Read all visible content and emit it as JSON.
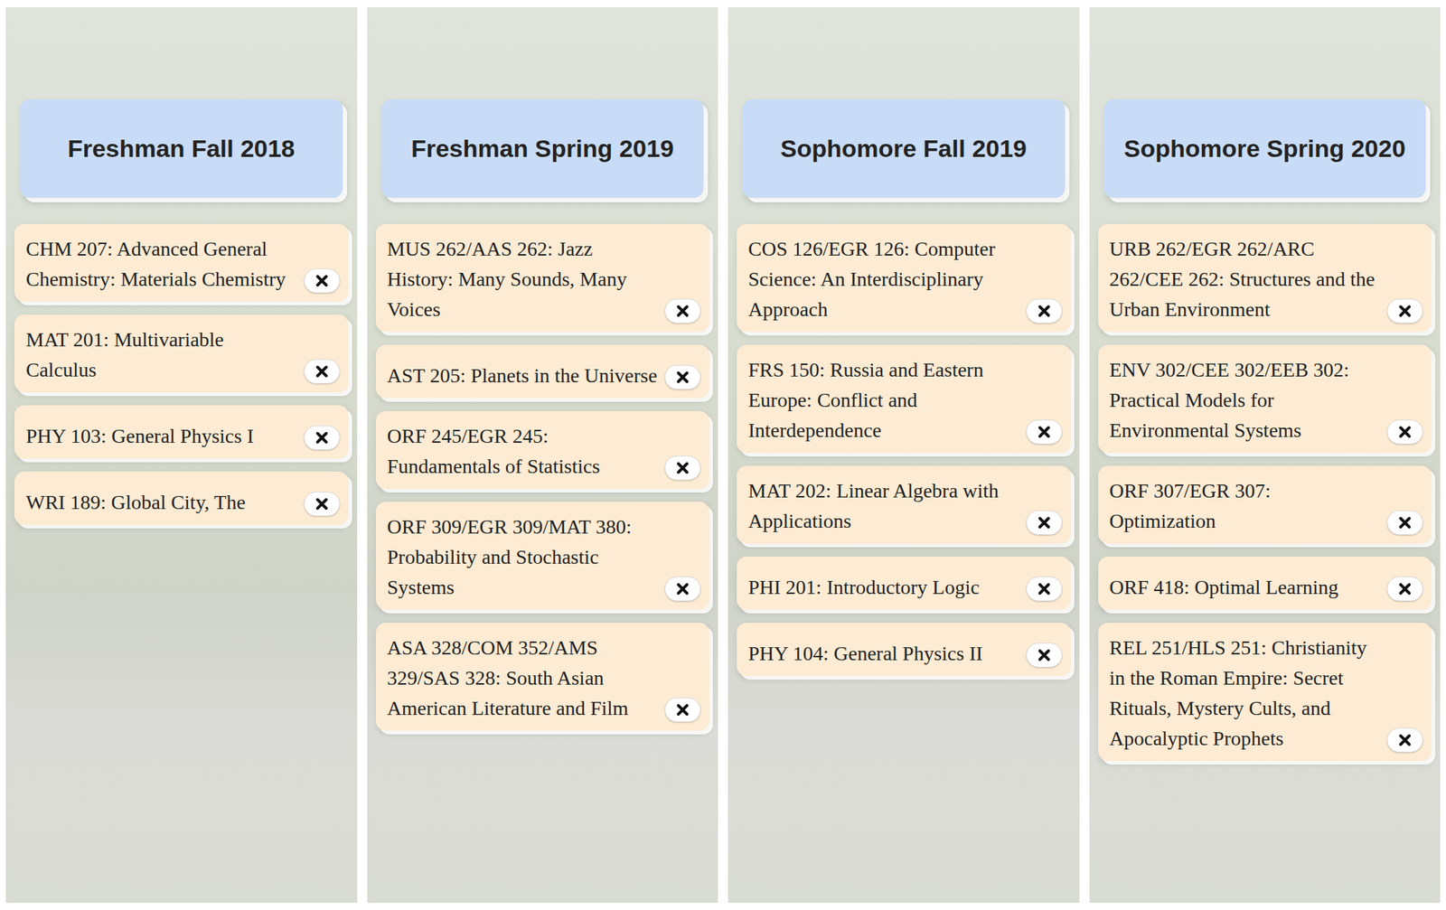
{
  "semesters": [
    {
      "title": "Freshman Fall 2018",
      "courses": [
        "CHM 207: Advanced General Chemistry: Materials Chemistry",
        "MAT 201: Multivariable Calculus",
        "PHY 103: General Physics I",
        "WRI 189: Global City, The"
      ]
    },
    {
      "title": "Freshman Spring 2019",
      "courses": [
        "MUS 262/AAS 262: Jazz History: Many Sounds, Many Voices",
        "AST 205: Planets in the Universe",
        "ORF 245/EGR 245: Fundamentals of Statistics",
        "ORF 309/EGR 309/MAT 380: Probability and Stochastic Systems",
        "ASA 328/COM 352/AMS 329/SAS 328: South Asian American Literature and Film"
      ]
    },
    {
      "title": "Sophomore Fall 2019",
      "courses": [
        "COS 126/EGR 126: Computer Science: An Interdisciplinary Approach",
        "FRS 150: Russia and Eastern Europe: Conflict and Interdependence",
        "MAT 202: Linear Algebra with Applications",
        "PHI 201: Introductory Logic",
        "PHY 104: General Physics II"
      ]
    },
    {
      "title": "Sophomore Spring 2020",
      "courses": [
        "URB 262/EGR 262/ARC 262/CEE 262: Structures and the Urban Environment",
        "ENV 302/CEE 302/EEB 302: Practical Models for Environmental Systems",
        "ORF 307/EGR 307: Optimization",
        "ORF 418: Optimal Learning",
        "REL 251/HLS 251: Christianity in the Roman Empire: Secret Rituals, Mystery Cults, and Apocalyptic Prophets"
      ]
    }
  ]
}
